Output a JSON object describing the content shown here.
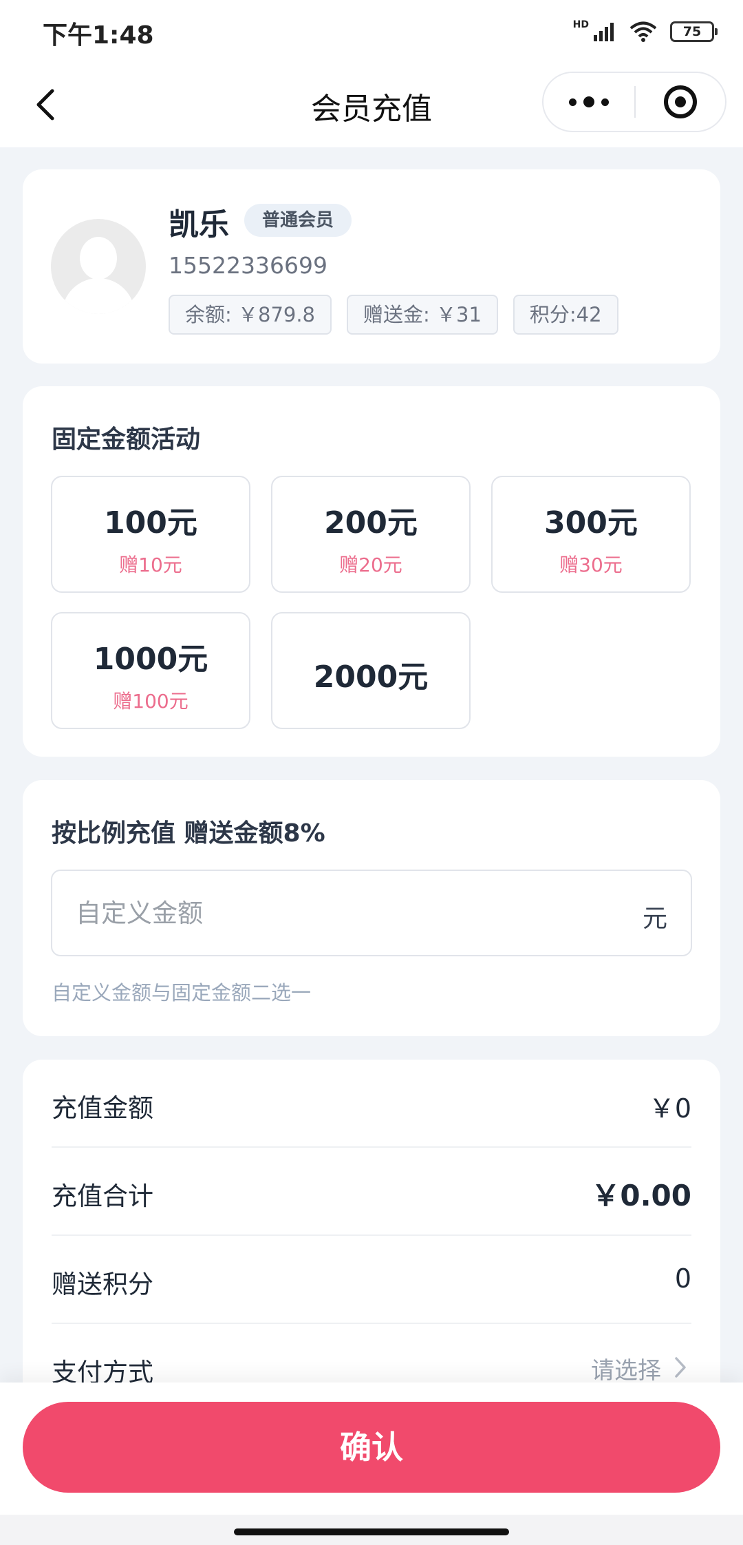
{
  "status_bar": {
    "time": "下午1:48",
    "network": "HD",
    "battery": "75"
  },
  "nav": {
    "title": "会员充值",
    "more_icon": "more-dots-icon",
    "close_icon": "target-close-icon",
    "back_icon": "chevron-left-icon"
  },
  "user": {
    "name": "凯乐",
    "level": "普通会员",
    "phone": "15522336699",
    "balance": "余额: ￥879.8",
    "gift_balance": "赠送金: ￥31",
    "points": "积分:42"
  },
  "fixed_activity": {
    "title": "固定金额活动",
    "packages": [
      {
        "amount": "100元",
        "gift": "赠10元"
      },
      {
        "amount": "200元",
        "gift": "赠20元"
      },
      {
        "amount": "300元",
        "gift": "赠30元"
      },
      {
        "amount": "1000元",
        "gift": "赠100元"
      },
      {
        "amount": "2000元",
        "gift": ""
      }
    ]
  },
  "ratio": {
    "title": "按比例充值 赠送金额8%",
    "input_placeholder": "自定义金额",
    "input_value": "",
    "unit": "元",
    "hint": "自定义金额与固定金额二选一"
  },
  "summary": {
    "recharge_amount_label": "充值金额",
    "recharge_amount_value": "￥0",
    "total_label": "充值合计",
    "total_value": "￥0.00",
    "points_label": "赠送积分",
    "points_value": "0",
    "payment_label": "支付方式",
    "payment_value": "请选择"
  },
  "confirm_label": "确认",
  "colors": {
    "accent": "#f14a6c",
    "gift_text": "#ec6d8d",
    "background": "#f1f4f8"
  }
}
